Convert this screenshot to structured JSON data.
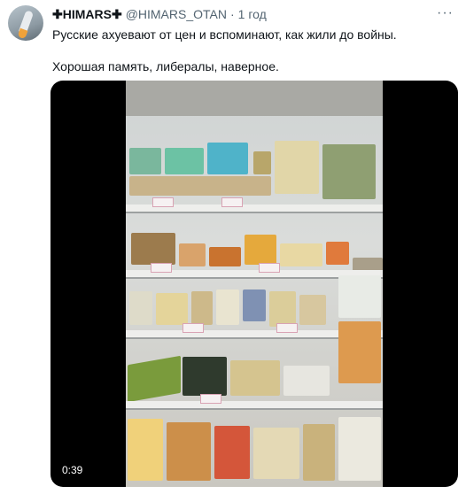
{
  "tweet": {
    "display_name": "✚HIMARS✚",
    "handle": "@HIMARS_OTAN",
    "separator": "·",
    "timestamp": "1 год",
    "more_icon": "more-horizontal-icon",
    "text_line_1": "Русские ахуевают от цен и вспоминают, как жили до войны.",
    "text_line_2": "Хорошая память, либералы, наверное."
  },
  "video": {
    "duration": "0:39"
  }
}
